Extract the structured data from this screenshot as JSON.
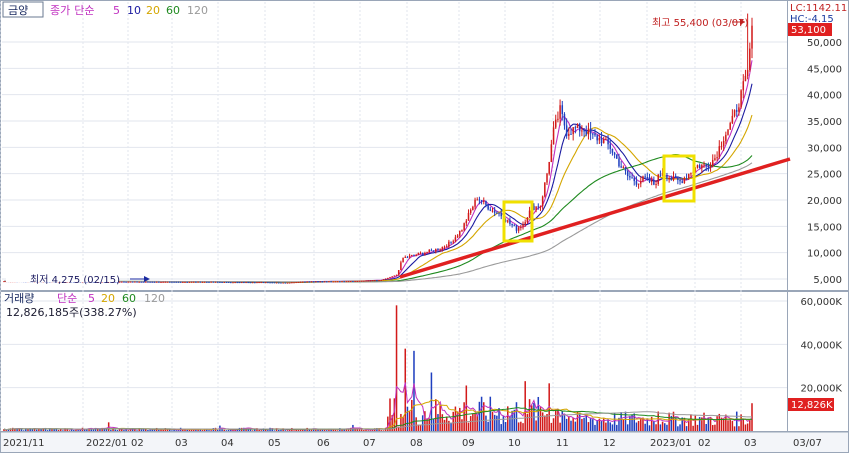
{
  "price_panel": {
    "title": "금양",
    "indicator": {
      "name": "종가",
      "type": "단순",
      "periods": [
        "5",
        "10",
        "20",
        "60",
        "120"
      ]
    },
    "lc_label": "LC:1142.11",
    "hc_label": "HC:-4.15",
    "current_price_label": "53,100",
    "high_label": "최고 55,400 (03/07)",
    "low_label": "최저 4,275 (02/15)"
  },
  "volume_panel": {
    "title": "거래량",
    "type": "단순",
    "periods": [
      "5",
      "20",
      "60",
      "120"
    ],
    "current_label": "12,826,185주(338.27%)",
    "current_box": "12,826K"
  },
  "colors": {
    "up": "#d21a1a",
    "down": "#1f3fbf",
    "ma5": "#c030c0",
    "ma10": "#1a1aa0",
    "ma20": "#d4a600",
    "ma60": "#1f8a1f",
    "ma120": "#9a9a9a",
    "trendline": "#e02020",
    "highlight": "#f0e000",
    "price_box": "#e02020"
  },
  "chart_data": [
    {
      "type": "candlestick",
      "y_ticks": [
        "5,000",
        "10,000",
        "15,000",
        "20,000",
        "25,000",
        "30,000",
        "35,000",
        "40,000",
        "45,000",
        "50,000"
      ],
      "ylim": [
        2500,
        58000
      ],
      "x_ticks": [
        "2021/11",
        "2022/01",
        "02",
        "03",
        "04",
        "05",
        "06",
        "07",
        "08",
        "09",
        "10",
        "11",
        "12",
        "2023/01",
        "02",
        "03",
        "03/07"
      ],
      "price_path": [
        [
          0,
          4600
        ],
        [
          30,
          4550
        ],
        [
          57,
          4500
        ],
        [
          75,
          4450
        ],
        [
          95,
          4450
        ],
        [
          105,
          4400
        ],
        [
          120,
          4400
        ],
        [
          129,
          4300
        ],
        [
          137,
          4500
        ],
        [
          160,
          4600
        ],
        [
          173,
          4800
        ],
        [
          176,
          5200
        ],
        [
          180,
          5800
        ],
        [
          183,
          9000
        ],
        [
          188,
          9500
        ],
        [
          193,
          10000
        ],
        [
          200,
          10800
        ],
        [
          205,
          12000
        ],
        [
          210,
          14500
        ],
        [
          214,
          18000
        ],
        [
          217,
          20500
        ],
        [
          221,
          19000
        ],
        [
          224,
          18000
        ],
        [
          227,
          17500
        ],
        [
          232,
          15500
        ],
        [
          235,
          14500
        ],
        [
          238,
          15500
        ],
        [
          242,
          18500
        ],
        [
          246,
          19000
        ],
        [
          249,
          25000
        ],
        [
          252,
          33000
        ],
        [
          255,
          37000
        ],
        [
          258,
          33000
        ],
        [
          262,
          33500
        ],
        [
          266,
          33500
        ],
        [
          270,
          32000
        ],
        [
          274,
          31500
        ],
        [
          278,
          30000
        ],
        [
          282,
          27000
        ],
        [
          286,
          24500
        ],
        [
          290,
          23500
        ],
        [
          294,
          24000
        ],
        [
          298,
          23000
        ],
        [
          302,
          25500
        ],
        [
          306,
          24000
        ],
        [
          310,
          23500
        ],
        [
          314,
          25000
        ],
        [
          318,
          26500
        ],
        [
          322,
          26500
        ],
        [
          326,
          28000
        ],
        [
          330,
          32000
        ],
        [
          334,
          35000
        ],
        [
          338,
          40000
        ],
        [
          341,
          44000
        ],
        [
          343,
          53100
        ]
      ],
      "ma_periods": [
        5,
        10,
        20,
        60,
        120
      ],
      "high": {
        "value": 55400,
        "date": "03/07"
      },
      "low": {
        "value": 4275,
        "date": "02/15"
      },
      "last": 53100,
      "trendline": {
        "from": "2022/07",
        "to": "2023/03"
      }
    },
    {
      "type": "bar",
      "title": "거래량",
      "y_ticks": [
        "20,000K",
        "40,000K",
        "60,000K"
      ],
      "ylim": [
        0,
        62000
      ],
      "unit": "K",
      "spikes": [
        [
          48,
          4000
        ],
        [
          99,
          2500
        ],
        [
          160,
          2800
        ],
        [
          180,
          58000
        ],
        [
          184,
          38000
        ],
        [
          188,
          37000
        ],
        [
          196,
          27000
        ],
        [
          212,
          21000
        ],
        [
          239,
          23000
        ],
        [
          250,
          22000
        ],
        [
          256,
          9000
        ],
        [
          300,
          9000
        ],
        [
          343,
          12826
        ]
      ],
      "last": 12826
    }
  ]
}
